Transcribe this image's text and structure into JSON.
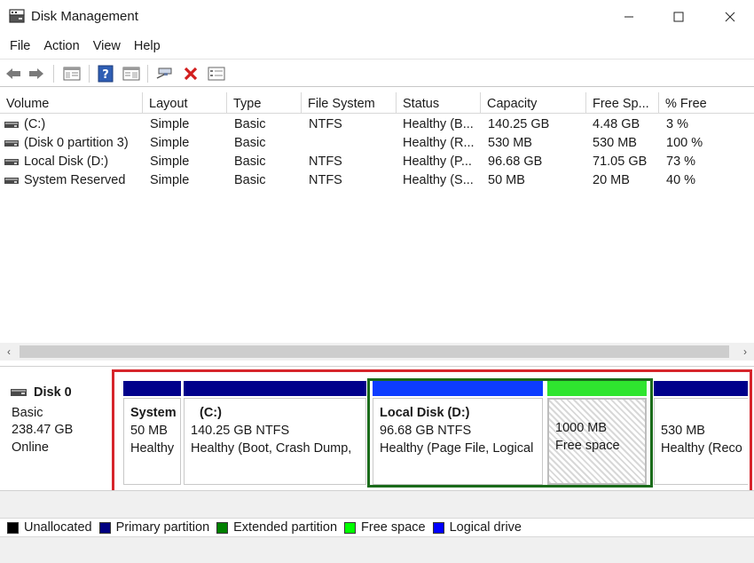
{
  "window": {
    "title": "Disk Management",
    "controls": {
      "minimize": "—",
      "maximize": "☐",
      "close": "✕"
    }
  },
  "menu": [
    "File",
    "Action",
    "View",
    "Help"
  ],
  "toolbar": {
    "icons": [
      "back-arrow-icon",
      "forward-arrow-icon",
      "console-tree-icon",
      "help-icon",
      "properties-icon",
      "connect-icon",
      "delete-icon",
      "list-view-icon"
    ]
  },
  "table": {
    "columns": [
      "Volume",
      "Layout",
      "Type",
      "File System",
      "Status",
      "Capacity",
      "Free Sp...",
      "% Free"
    ],
    "rows": [
      [
        "(C:)",
        "Simple",
        "Basic",
        "NTFS",
        "Healthy (B...",
        "140.25 GB",
        "4.48 GB",
        "3 %"
      ],
      [
        "(Disk 0 partition 3)",
        "Simple",
        "Basic",
        "",
        "Healthy (R...",
        "530 MB",
        "530 MB",
        "100 %"
      ],
      [
        "Local Disk (D:)",
        "Simple",
        "Basic",
        "NTFS",
        "Healthy (P...",
        "96.68 GB",
        "71.05 GB",
        "73 %"
      ],
      [
        "System Reserved",
        "Simple",
        "Basic",
        "NTFS",
        "Healthy (S...",
        "50 MB",
        "20 MB",
        "40 %"
      ]
    ]
  },
  "scrollbar": {
    "left": "‹",
    "right": "›"
  },
  "disk": {
    "name": "Disk 0",
    "type": "Basic",
    "size": "238.47 GB",
    "status": "Online"
  },
  "partitions": [
    {
      "title": "System",
      "size": "50 MB",
      "status": "Healthy"
    },
    {
      "title": "(C:)",
      "size": "140.25 GB NTFS",
      "status": "Healthy (Boot, Crash Dump,"
    },
    {
      "title": "Local Disk  (D:)",
      "size": "96.68 GB NTFS",
      "status": "Healthy (Page File, Logical"
    },
    {
      "title": "",
      "size": "1000 MB",
      "status": "Free space"
    },
    {
      "title": "",
      "size": "530 MB",
      "status": "Healthy (Reco"
    }
  ],
  "legend": [
    {
      "label": "Unallocated",
      "color": "#000000"
    },
    {
      "label": "Primary partition",
      "color": "#000080"
    },
    {
      "label": "Extended partition",
      "color": "#008000"
    },
    {
      "label": "Free space",
      "color": "#00ff00"
    },
    {
      "label": "Logical drive",
      "color": "#0000ff"
    }
  ],
  "colors": {
    "primary": "#00008b",
    "logical": "#0d3cff",
    "free": "#2fe52f",
    "highlight_red": "#d6252b",
    "highlight_green": "#1a6b1a"
  }
}
